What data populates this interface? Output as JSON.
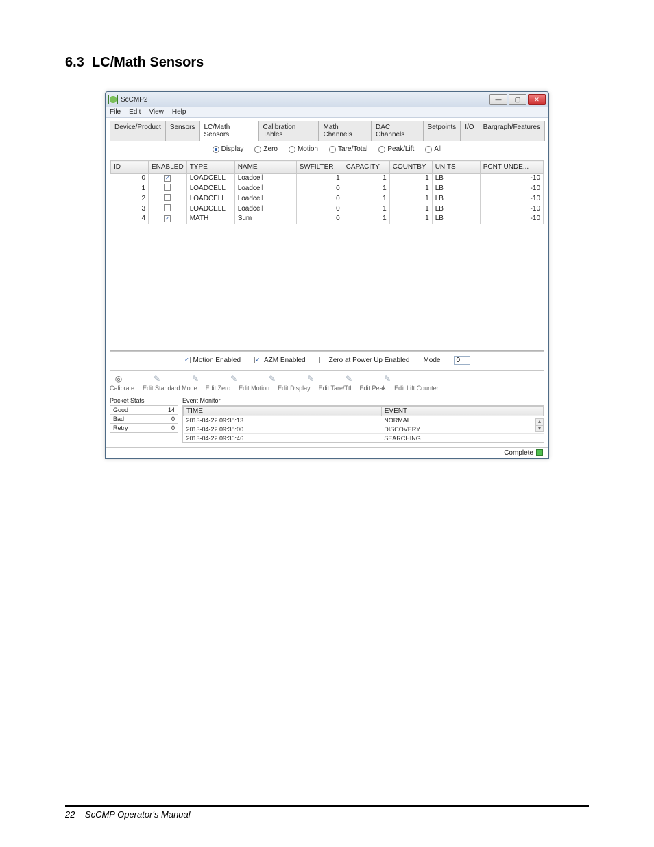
{
  "section": {
    "number": "6.3",
    "title": "LC/Math Sensors"
  },
  "window": {
    "title": "ScCMP2",
    "menu": [
      "File",
      "Edit",
      "View",
      "Help"
    ],
    "tabs": [
      "Device/Product",
      "Sensors",
      "LC/Math Sensors",
      "Calibration Tables",
      "Math Channels",
      "DAC Channels",
      "Setpoints",
      "I/O",
      "Bargraph/Features"
    ],
    "active_tab": "LC/Math Sensors",
    "view_modes": [
      "Display",
      "Zero",
      "Motion",
      "Tare/Total",
      "Peak/Lift",
      "All"
    ],
    "active_view": "Display",
    "grid": {
      "columns": [
        "ID",
        "ENABLED",
        "TYPE",
        "NAME",
        "SWFILTER",
        "CAPACITY",
        "COUNTBY",
        "UNITS",
        "PCNT UNDE..."
      ],
      "rows": [
        {
          "id": "0",
          "enabled": true,
          "type": "LOADCELL",
          "name": "Loadcell",
          "swfilter": "1",
          "capacity": "1",
          "countby": "1",
          "units": "LB",
          "pcnt": "-10"
        },
        {
          "id": "1",
          "enabled": false,
          "type": "LOADCELL",
          "name": "Loadcell",
          "swfilter": "0",
          "capacity": "1",
          "countby": "1",
          "units": "LB",
          "pcnt": "-10"
        },
        {
          "id": "2",
          "enabled": false,
          "type": "LOADCELL",
          "name": "Loadcell",
          "swfilter": "0",
          "capacity": "1",
          "countby": "1",
          "units": "LB",
          "pcnt": "-10"
        },
        {
          "id": "3",
          "enabled": false,
          "type": "LOADCELL",
          "name": "Loadcell",
          "swfilter": "0",
          "capacity": "1",
          "countby": "1",
          "units": "LB",
          "pcnt": "-10"
        },
        {
          "id": "4",
          "enabled": true,
          "type": "MATH",
          "name": "Sum",
          "swfilter": "0",
          "capacity": "1",
          "countby": "1",
          "units": "LB",
          "pcnt": "-10"
        }
      ]
    },
    "bottom_options": {
      "motion_enabled": {
        "label": "Motion Enabled",
        "checked": true
      },
      "azm_enabled": {
        "label": "AZM Enabled",
        "checked": true
      },
      "zero_powerup": {
        "label": "Zero at Power Up Enabled",
        "checked": false
      },
      "mode_label": "Mode",
      "mode_value": "0"
    },
    "toolbelt": [
      "Calibrate",
      "Edit Standard Mode",
      "Edit Zero",
      "Edit Motion",
      "Edit Display",
      "Edit Tare/Ttl",
      "Edit Peak",
      "Edit Lift Counter"
    ],
    "packet_stats": {
      "title": "Packet Stats",
      "rows": [
        {
          "label": "Good",
          "value": "14"
        },
        {
          "label": "Bad",
          "value": "0"
        },
        {
          "label": "Retry",
          "value": "0"
        }
      ]
    },
    "event_monitor": {
      "title": "Event Monitor",
      "columns": [
        "TIME",
        "EVENT"
      ],
      "rows": [
        {
          "time": "2013-04-22 09:38:13",
          "event": "NORMAL"
        },
        {
          "time": "2013-04-22 09:38:00",
          "event": "DISCOVERY"
        },
        {
          "time": "2013-04-22 09:36:46",
          "event": "SEARCHING"
        }
      ]
    },
    "status": "Complete"
  },
  "footer": {
    "page": "22",
    "doc": "ScCMP Operator's Manual"
  }
}
